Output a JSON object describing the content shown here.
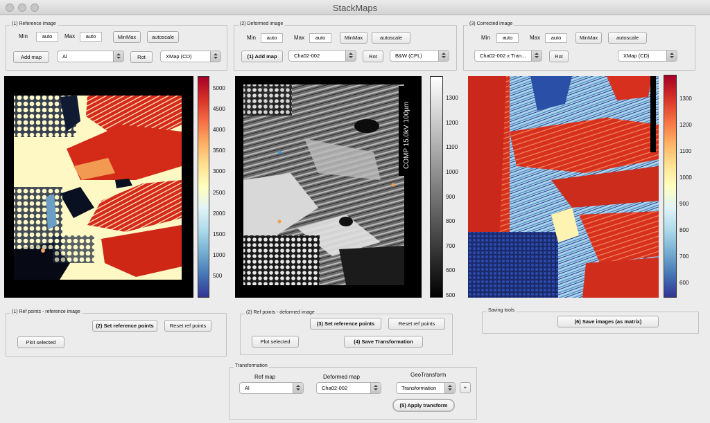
{
  "window": {
    "title": "StackMaps"
  },
  "reference": {
    "panel_label": "(1) Reference image",
    "min_label": "Min",
    "min_value": "auto",
    "max_label": "Max",
    "max_value": "auto",
    "minmax_button": "MinMax",
    "autoscale_button": "autoscale",
    "add_map_button": "Add map",
    "map_select": "Al",
    "rot_button": "Rot",
    "mode_select": "XMap (CD)",
    "colorbar_ticks": [
      "5000",
      "4500",
      "4000",
      "3500",
      "3000",
      "2500",
      "2000",
      "1500",
      "1000",
      "500"
    ]
  },
  "deformed": {
    "panel_label": "(2) Deformed image",
    "min_label": "Min",
    "min_value": "auto",
    "max_label": "Max",
    "max_value": "auto",
    "minmax_button": "MinMax",
    "autoscale_button": "autoscale",
    "add_map_button": "(1) Add map",
    "map_select": "Cha02-002",
    "rot_button": "Rot",
    "mode_select": "B&W (CPL)",
    "image_annotation": "COMP 15.0kV 100µm",
    "colorbar_ticks": [
      "1300",
      "1200",
      "1100",
      "1000",
      "900",
      "800",
      "700",
      "600",
      "500"
    ]
  },
  "corrected": {
    "panel_label": "(3) Corrected image",
    "min_label": "Min",
    "min_value": "auto",
    "max_label": "Max",
    "max_value": "auto",
    "minmax_button": "MinMax",
    "autoscale_button": "autoscale",
    "map_select": "Cha02-002 x Tran...",
    "rot_button": "Rot",
    "mode_select": "XMap (CD)",
    "colorbar_ticks": [
      "1300",
      "1200",
      "1100",
      "1000",
      "900",
      "800",
      "700",
      "600"
    ]
  },
  "ref_points_reference": {
    "panel_label": "(1) Ref points - reference image",
    "set_button": "(2) Set reference points",
    "reset_button": "Reset ref points",
    "plot_button": "Plot selected"
  },
  "ref_points_deformed": {
    "panel_label": "(2) Ref points - deformed image",
    "set_button": "(3) Set reference points",
    "reset_button": "Reset ref points",
    "plot_button": "Plot selected",
    "save_button": "(4) Save Transformation"
  },
  "saving_tools": {
    "panel_label": "Saving tools",
    "save_button": "(6) Save images (as matrix)"
  },
  "transformation": {
    "panel_label": "Transformation",
    "ref_map_label": "Ref map",
    "ref_map_select": "Al",
    "deformed_map_label": "Deformed map",
    "deformed_map_select": "Cha02-002",
    "geotransform_label": "GeoTransform",
    "geotransform_select": "Transformation",
    "plus_button": "+",
    "apply_button": "(5) Apply transform"
  }
}
